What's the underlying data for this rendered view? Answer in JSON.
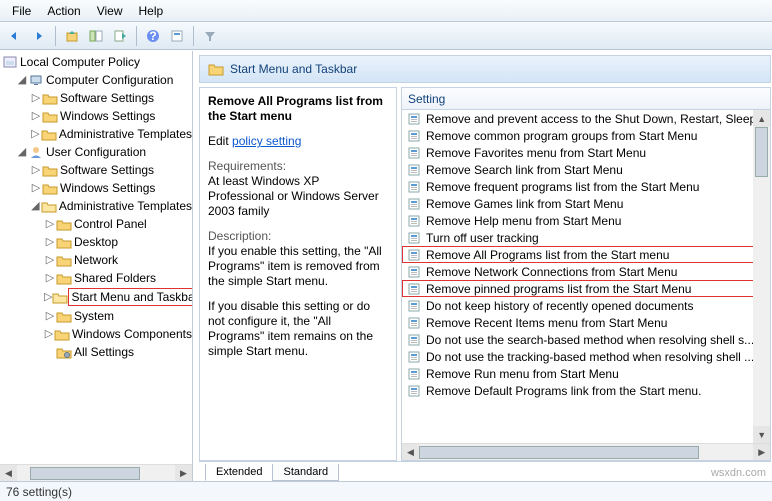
{
  "menu": {
    "file": "File",
    "action": "Action",
    "view": "View",
    "help": "Help"
  },
  "tree": {
    "root": "Local Computer Policy",
    "cc": "Computer Configuration",
    "cc_items": [
      "Software Settings",
      "Windows Settings",
      "Administrative Templates"
    ],
    "uc": "User Configuration",
    "uc_items": [
      "Software Settings",
      "Windows Settings",
      "Administrative Templates"
    ],
    "at_items": [
      "Control Panel",
      "Desktop",
      "Network",
      "Shared Folders",
      "Start Menu and Taskbar",
      "System",
      "Windows Components",
      "All Settings"
    ]
  },
  "header": "Start Menu and Taskbar",
  "desc": {
    "title": "Remove All Programs list from the Start menu",
    "edit_prefix": "Edit",
    "edit_link": "policy setting",
    "req_label": "Requirements:",
    "req_body": "At least Windows XP Professional or Windows Server 2003 family",
    "desc_label": "Description:",
    "desc_body1": "If you enable this setting, the \"All Programs\" item is removed from the simple Start menu.",
    "desc_body2": "If you disable this setting or do not configure it, the \"All Programs\" item remains on the simple Start menu."
  },
  "list": {
    "col": "Setting",
    "items": [
      "Remove and prevent access to the Shut Down, Restart, Sleep...",
      "Remove common program groups from Start Menu",
      "Remove Favorites menu from Start Menu",
      "Remove Search link from Start Menu",
      "Remove frequent programs list from the Start Menu",
      "Remove Games link from Start Menu",
      "Remove Help menu from Start Menu",
      "Turn off user tracking",
      "Remove All Programs list from the Start menu",
      "Remove Network Connections from Start Menu",
      "Remove pinned programs list from the Start Menu",
      "Do not keep history of recently opened documents",
      "Remove Recent Items menu from Start Menu",
      "Do not use the search-based method when resolving shell s...",
      "Do not use the tracking-based method when resolving shell ...",
      "Remove Run menu from Start Menu",
      "Remove Default Programs link from the Start menu."
    ],
    "highlight": [
      8,
      10
    ]
  },
  "tabs": {
    "extended": "Extended",
    "standard": "Standard"
  },
  "status": "76 setting(s)",
  "watermark": "wsxdn.com"
}
